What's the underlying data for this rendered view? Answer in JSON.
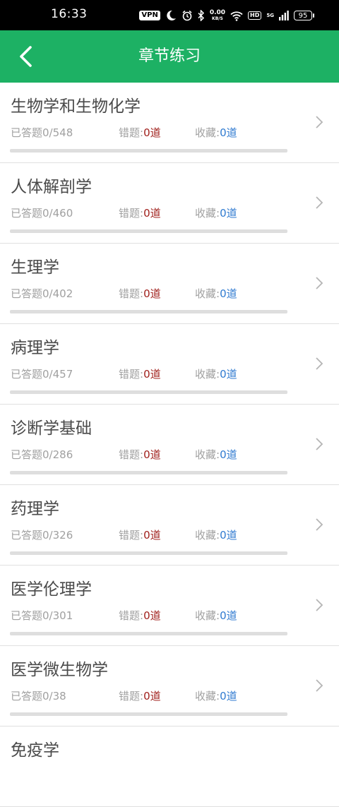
{
  "status_bar": {
    "time": "16:33",
    "vpn_label": "VPN",
    "speed_value": "0.00",
    "speed_unit": "KB/S",
    "hd_label": "HD",
    "network_label": "5G",
    "battery": "95",
    "icons": [
      "moon-icon",
      "alarm-icon",
      "bluetooth-icon",
      "wifi-icon",
      "signal-icon"
    ]
  },
  "header": {
    "title": "章节练习",
    "back_icon": "chevron-left-icon",
    "color": "#1db164"
  },
  "labels": {
    "answered_prefix": "已答题",
    "wrong_prefix": "错题:",
    "fav_prefix": "收藏:"
  },
  "colors": {
    "wrong_value": "#a0201c",
    "fav_value": "#2f7ad0"
  },
  "chapters": [
    {
      "title": "生物学和生物化学",
      "answered": "0/548",
      "answered_fraction": 0,
      "wrong": "0道",
      "favorites": "0道"
    },
    {
      "title": "人体解剖学",
      "answered": "0/460",
      "answered_fraction": 0,
      "wrong": "0道",
      "favorites": "0道"
    },
    {
      "title": "生理学",
      "answered": "0/402",
      "answered_fraction": 0,
      "wrong": "0道",
      "favorites": "0道"
    },
    {
      "title": "病理学",
      "answered": "0/457",
      "answered_fraction": 0,
      "wrong": "0道",
      "favorites": "0道"
    },
    {
      "title": "诊断学基础",
      "answered": "0/286",
      "answered_fraction": 0,
      "wrong": "0道",
      "favorites": "0道"
    },
    {
      "title": "药理学",
      "answered": "0/326",
      "answered_fraction": 0,
      "wrong": "0道",
      "favorites": "0道"
    },
    {
      "title": "医学伦理学",
      "answered": "0/301",
      "answered_fraction": 0,
      "wrong": "0道",
      "favorites": "0道"
    },
    {
      "title": "医学微生物学",
      "answered": "0/38",
      "answered_fraction": 0,
      "wrong": "0道",
      "favorites": "0道"
    },
    {
      "title": "免疫学"
    }
  ]
}
